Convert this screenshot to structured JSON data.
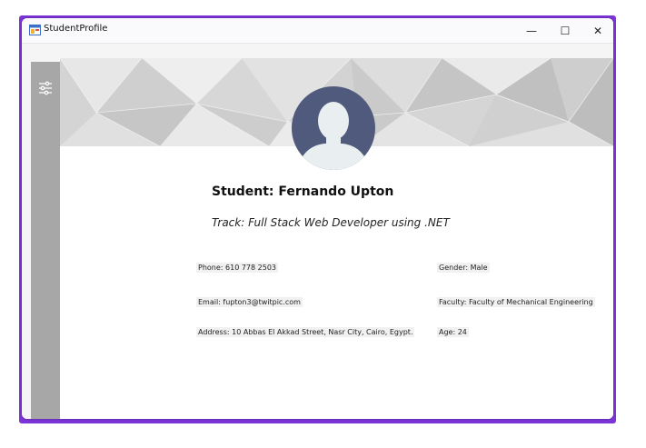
{
  "window": {
    "title": "StudentProfile",
    "minimize_glyph": "—",
    "maximize_glyph": "☐",
    "close_glyph": "✕"
  },
  "sidebar": {
    "icon": "settings-sliders-icon"
  },
  "profile": {
    "avatar_icon": "user-avatar-icon",
    "name": "Student: Fernando Upton",
    "track": "Track: Full Stack Web Developer using .NET",
    "phone": "Phone: 610 778 2503",
    "gender": "Gender: Male",
    "email": "Email: fupton3@twitpic.com",
    "faculty": "Faculty: Faculty of Mechanical Engineering",
    "address": "Address: 10 Abbas El Akkad Street, Nasr City, Cairo, Egypt.",
    "age": "Age: 24"
  },
  "colors": {
    "window_frame": "#7b34d6",
    "sidebar": "#a7a7a7",
    "avatar_circle": "#4f5a7c",
    "avatar_silhouette": "#e9eef0"
  }
}
